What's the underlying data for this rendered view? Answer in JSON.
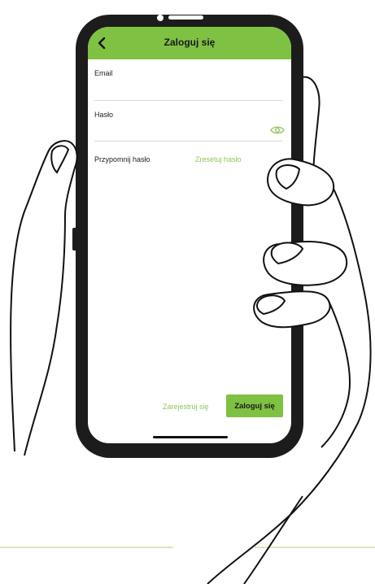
{
  "header": {
    "title": "Zaloguj się",
    "back_icon": "chevron-left-icon"
  },
  "form": {
    "email_label": "Email",
    "email_value": "",
    "password_label": "Hasło",
    "password_value": "",
    "password_toggle_icon": "eye-icon"
  },
  "remember": {
    "label": "Przypomnij hasło",
    "reset_link": "Zresetuj hasło"
  },
  "footer": {
    "register_link": "Zarejestruj się",
    "login_button": "Zaloguj się"
  },
  "colors": {
    "accent": "#7fc142",
    "link": "#8cc65a",
    "frame": "#1c1c1c",
    "decor_line": "#dde6b8"
  }
}
